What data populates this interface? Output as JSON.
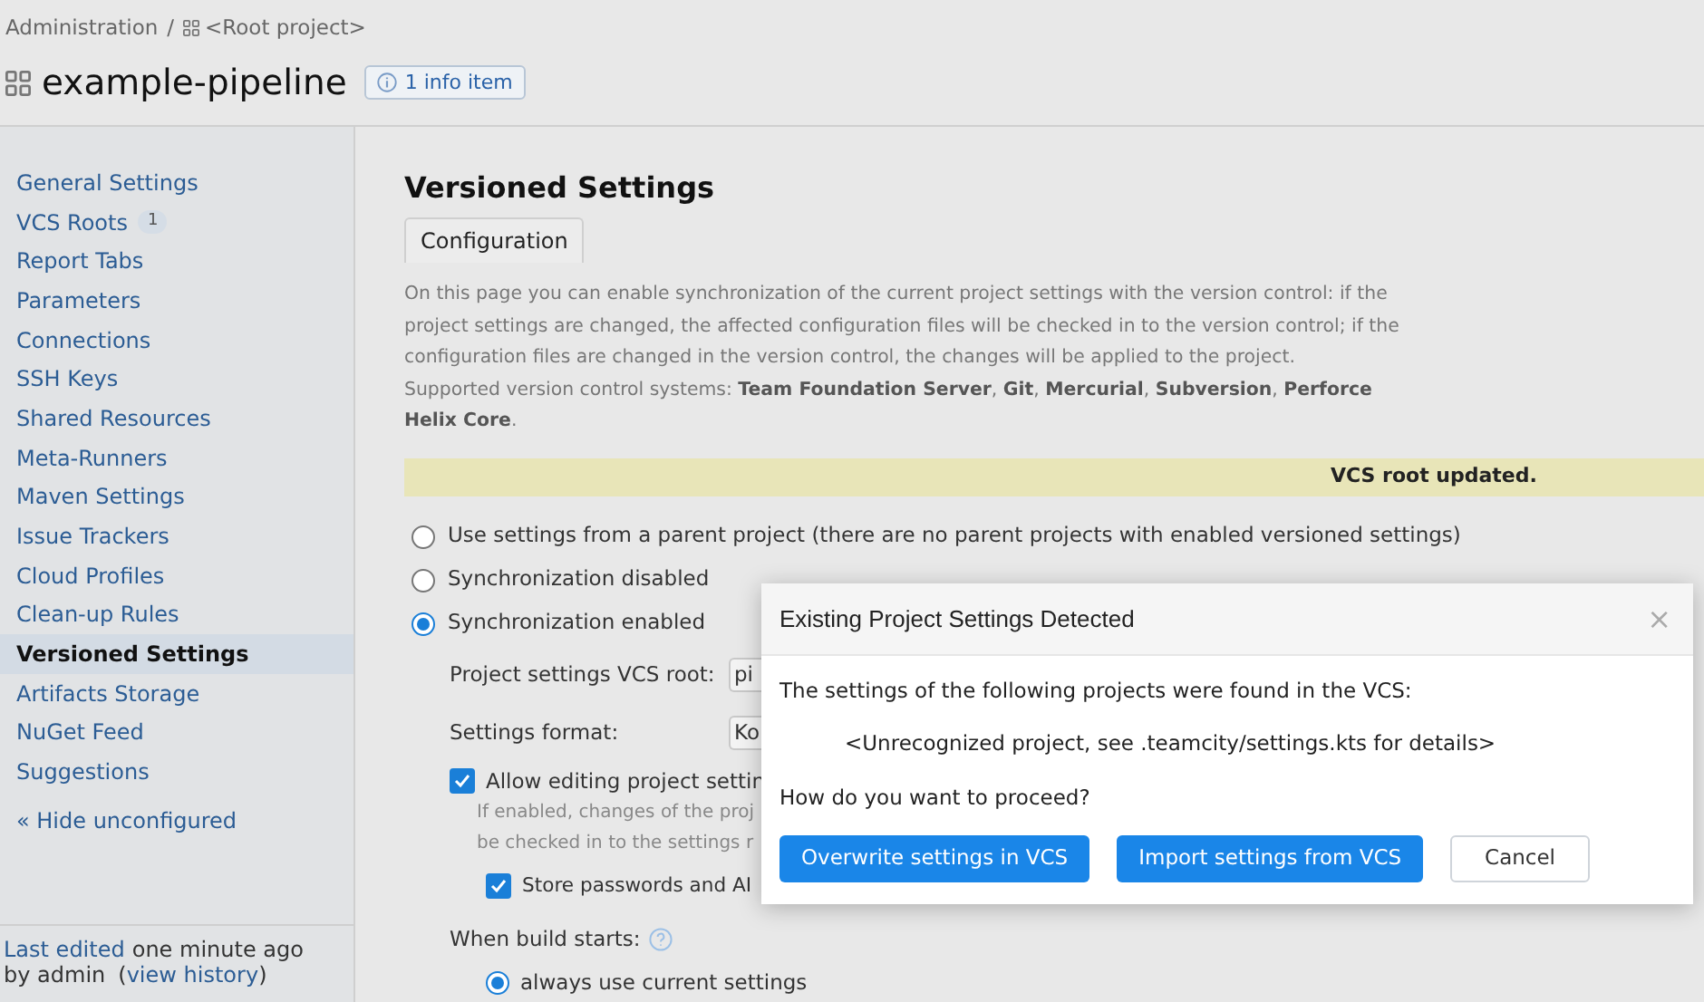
{
  "breadcrumb": {
    "parent": "Administration",
    "separator": "/",
    "current": "<Root project>"
  },
  "header": {
    "title": "example-pipeline",
    "info_badge": "1 info item"
  },
  "sidebar": {
    "items": [
      {
        "label": "General Settings",
        "selected": false
      },
      {
        "label": "VCS Roots",
        "selected": false,
        "count": "1"
      },
      {
        "label": "Report Tabs",
        "selected": false
      },
      {
        "label": "Parameters",
        "selected": false
      },
      {
        "label": "Connections",
        "selected": false
      },
      {
        "label": "SSH Keys",
        "selected": false
      },
      {
        "label": "Shared Resources",
        "selected": false
      },
      {
        "label": "Meta-Runners",
        "selected": false
      },
      {
        "label": "Maven Settings",
        "selected": false
      },
      {
        "label": "Issue Trackers",
        "selected": false
      },
      {
        "label": "Cloud Profiles",
        "selected": false
      },
      {
        "label": "Clean-up Rules",
        "selected": false
      },
      {
        "label": "Versioned Settings",
        "selected": true
      },
      {
        "label": "Artifacts Storage",
        "selected": false
      },
      {
        "label": "NuGet Feed",
        "selected": false
      },
      {
        "label": "Suggestions",
        "selected": false
      }
    ],
    "toggle": "« Hide unconfigured",
    "footer": {
      "link": "Last edited",
      "text1": "one minute ago",
      "text2": "by admin",
      "history_open": "(",
      "history_link": "view history",
      "history_close": ")"
    }
  },
  "main": {
    "title": "Versioned Settings",
    "tabs": [
      {
        "label": "Configuration",
        "selected": true
      }
    ],
    "description": "On this page you can enable synchronization of the current project settings with the version control: if the project settings are changed, the affected configuration files will be checked in to the version control; if the configuration files are changed in the version control, the changes will be applied to the project.",
    "supported": "Supported version control systems: **Team Foundation Server**, **Git**, **Mercurial**, **Subversion**, **Perforce Helix Core**.",
    "notice": "VCS root updated.",
    "modes": [
      {
        "label": "Use settings from a parent project (there are no parent projects with enabled versioned settings)",
        "selected": false
      },
      {
        "label": "Synchronization disabled",
        "selected": false
      },
      {
        "label": "Synchronization enabled",
        "selected": true
      }
    ],
    "vcs_root": {
      "label": "Project settings VCS root:",
      "value": "pi"
    },
    "format": {
      "label": "Settings format:",
      "value": "Ko"
    },
    "allow_editing": {
      "label": "Allow editing project settin",
      "checked": true,
      "hint_lines": [
        "If enabled, changes of the proj",
        "be checked in to the settings r"
      ]
    },
    "store_passwords": {
      "label": "Store passwords and AI",
      "checked": true
    },
    "build_starts": {
      "label": "When build starts:",
      "options": [
        {
          "label": "always use current settings",
          "selected": true
        }
      ]
    }
  },
  "dialog": {
    "title": "Existing Project Settings Detected",
    "close": "×",
    "intro": "The settings of the following projects were found in the VCS:",
    "project": "<Unrecognized project, see .teamcity/settings.kts for details>",
    "question": "How do you want to proceed?",
    "buttons": [
      {
        "label": "Overwrite settings in VCS",
        "kind": "primary"
      },
      {
        "label": "Import settings from VCS",
        "kind": "primary"
      },
      {
        "label": "Cancel",
        "kind": "secondary"
      }
    ]
  }
}
